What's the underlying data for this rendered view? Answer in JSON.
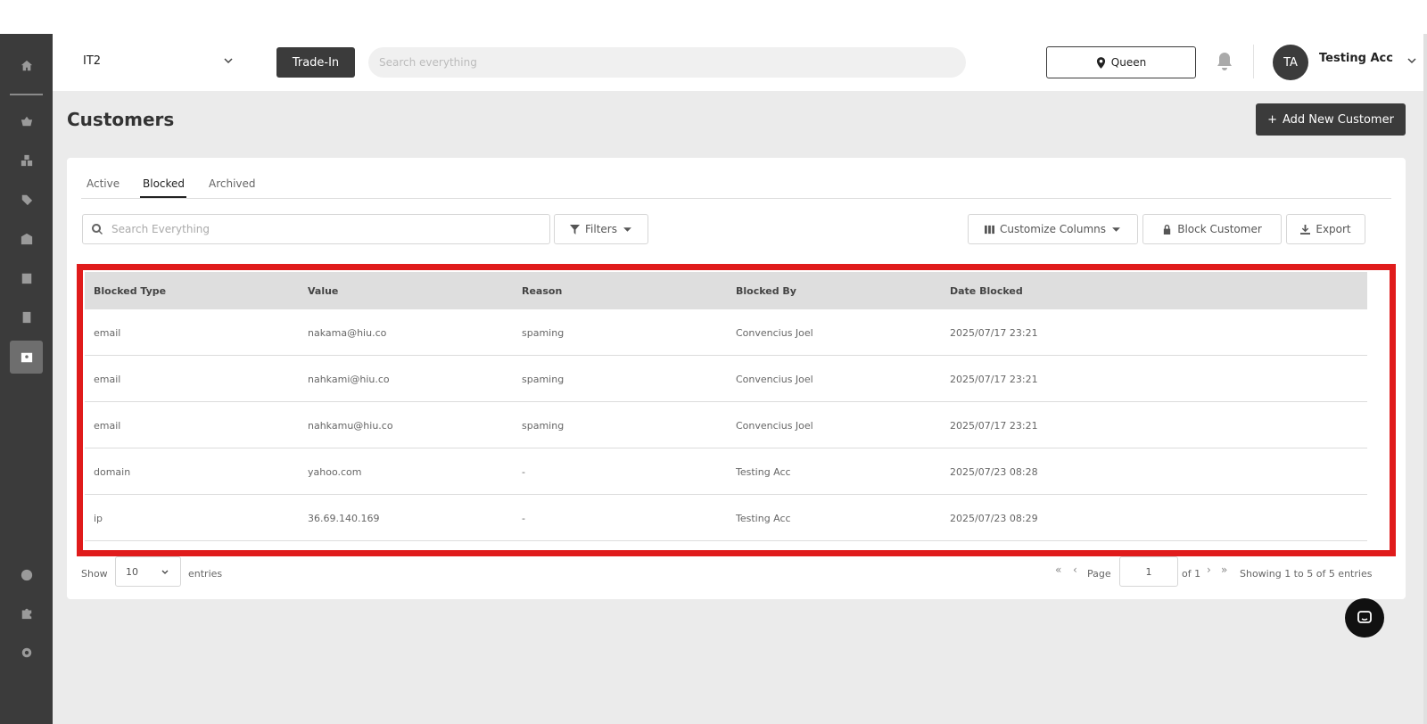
{
  "header": {
    "store": "IT2",
    "trade_in_label": "Trade-In",
    "search_placeholder": "Search everything",
    "location": "Queen",
    "user_initials": "TA",
    "user_name": "Testing Acc"
  },
  "page": {
    "title": "Customers",
    "add_button": "Add New Customer"
  },
  "tabs": [
    {
      "label": "Active"
    },
    {
      "label": "Blocked"
    },
    {
      "label": "Archived"
    }
  ],
  "toolbar": {
    "search_placeholder": "Search Everything",
    "filters": "Filters",
    "customize_columns": "Customize Columns",
    "block_customer": "Block Customer",
    "export": "Export"
  },
  "table": {
    "columns": [
      "Blocked Type",
      "Value",
      "Reason",
      "Blocked By",
      "Date Blocked"
    ],
    "rows": [
      [
        "email",
        "nakama@hiu.co",
        "spaming",
        "Convencius Joel",
        "2025/07/17 23:21"
      ],
      [
        "email",
        "nahkami@hiu.co",
        "spaming",
        "Convencius Joel",
        "2025/07/17 23:21"
      ],
      [
        "email",
        "nahkamu@hiu.co",
        "spaming",
        "Convencius Joel",
        "2025/07/17 23:21"
      ],
      [
        "domain",
        "yahoo.com",
        "-",
        "Testing Acc",
        "2025/07/23 08:28"
      ],
      [
        "ip",
        "36.69.140.169",
        "-",
        "Testing Acc",
        "2025/07/23 08:29"
      ]
    ]
  },
  "pagination": {
    "show": "Show",
    "page_size": "10",
    "entries": "entries",
    "page": "Page",
    "current": "1",
    "of": "of 1",
    "summary": "Showing 1 to 5 of 5 entries"
  },
  "colors": {
    "sidebar": "#3b3b3b",
    "highlight": "#e01b1b",
    "accent": "#3b3b3b"
  }
}
